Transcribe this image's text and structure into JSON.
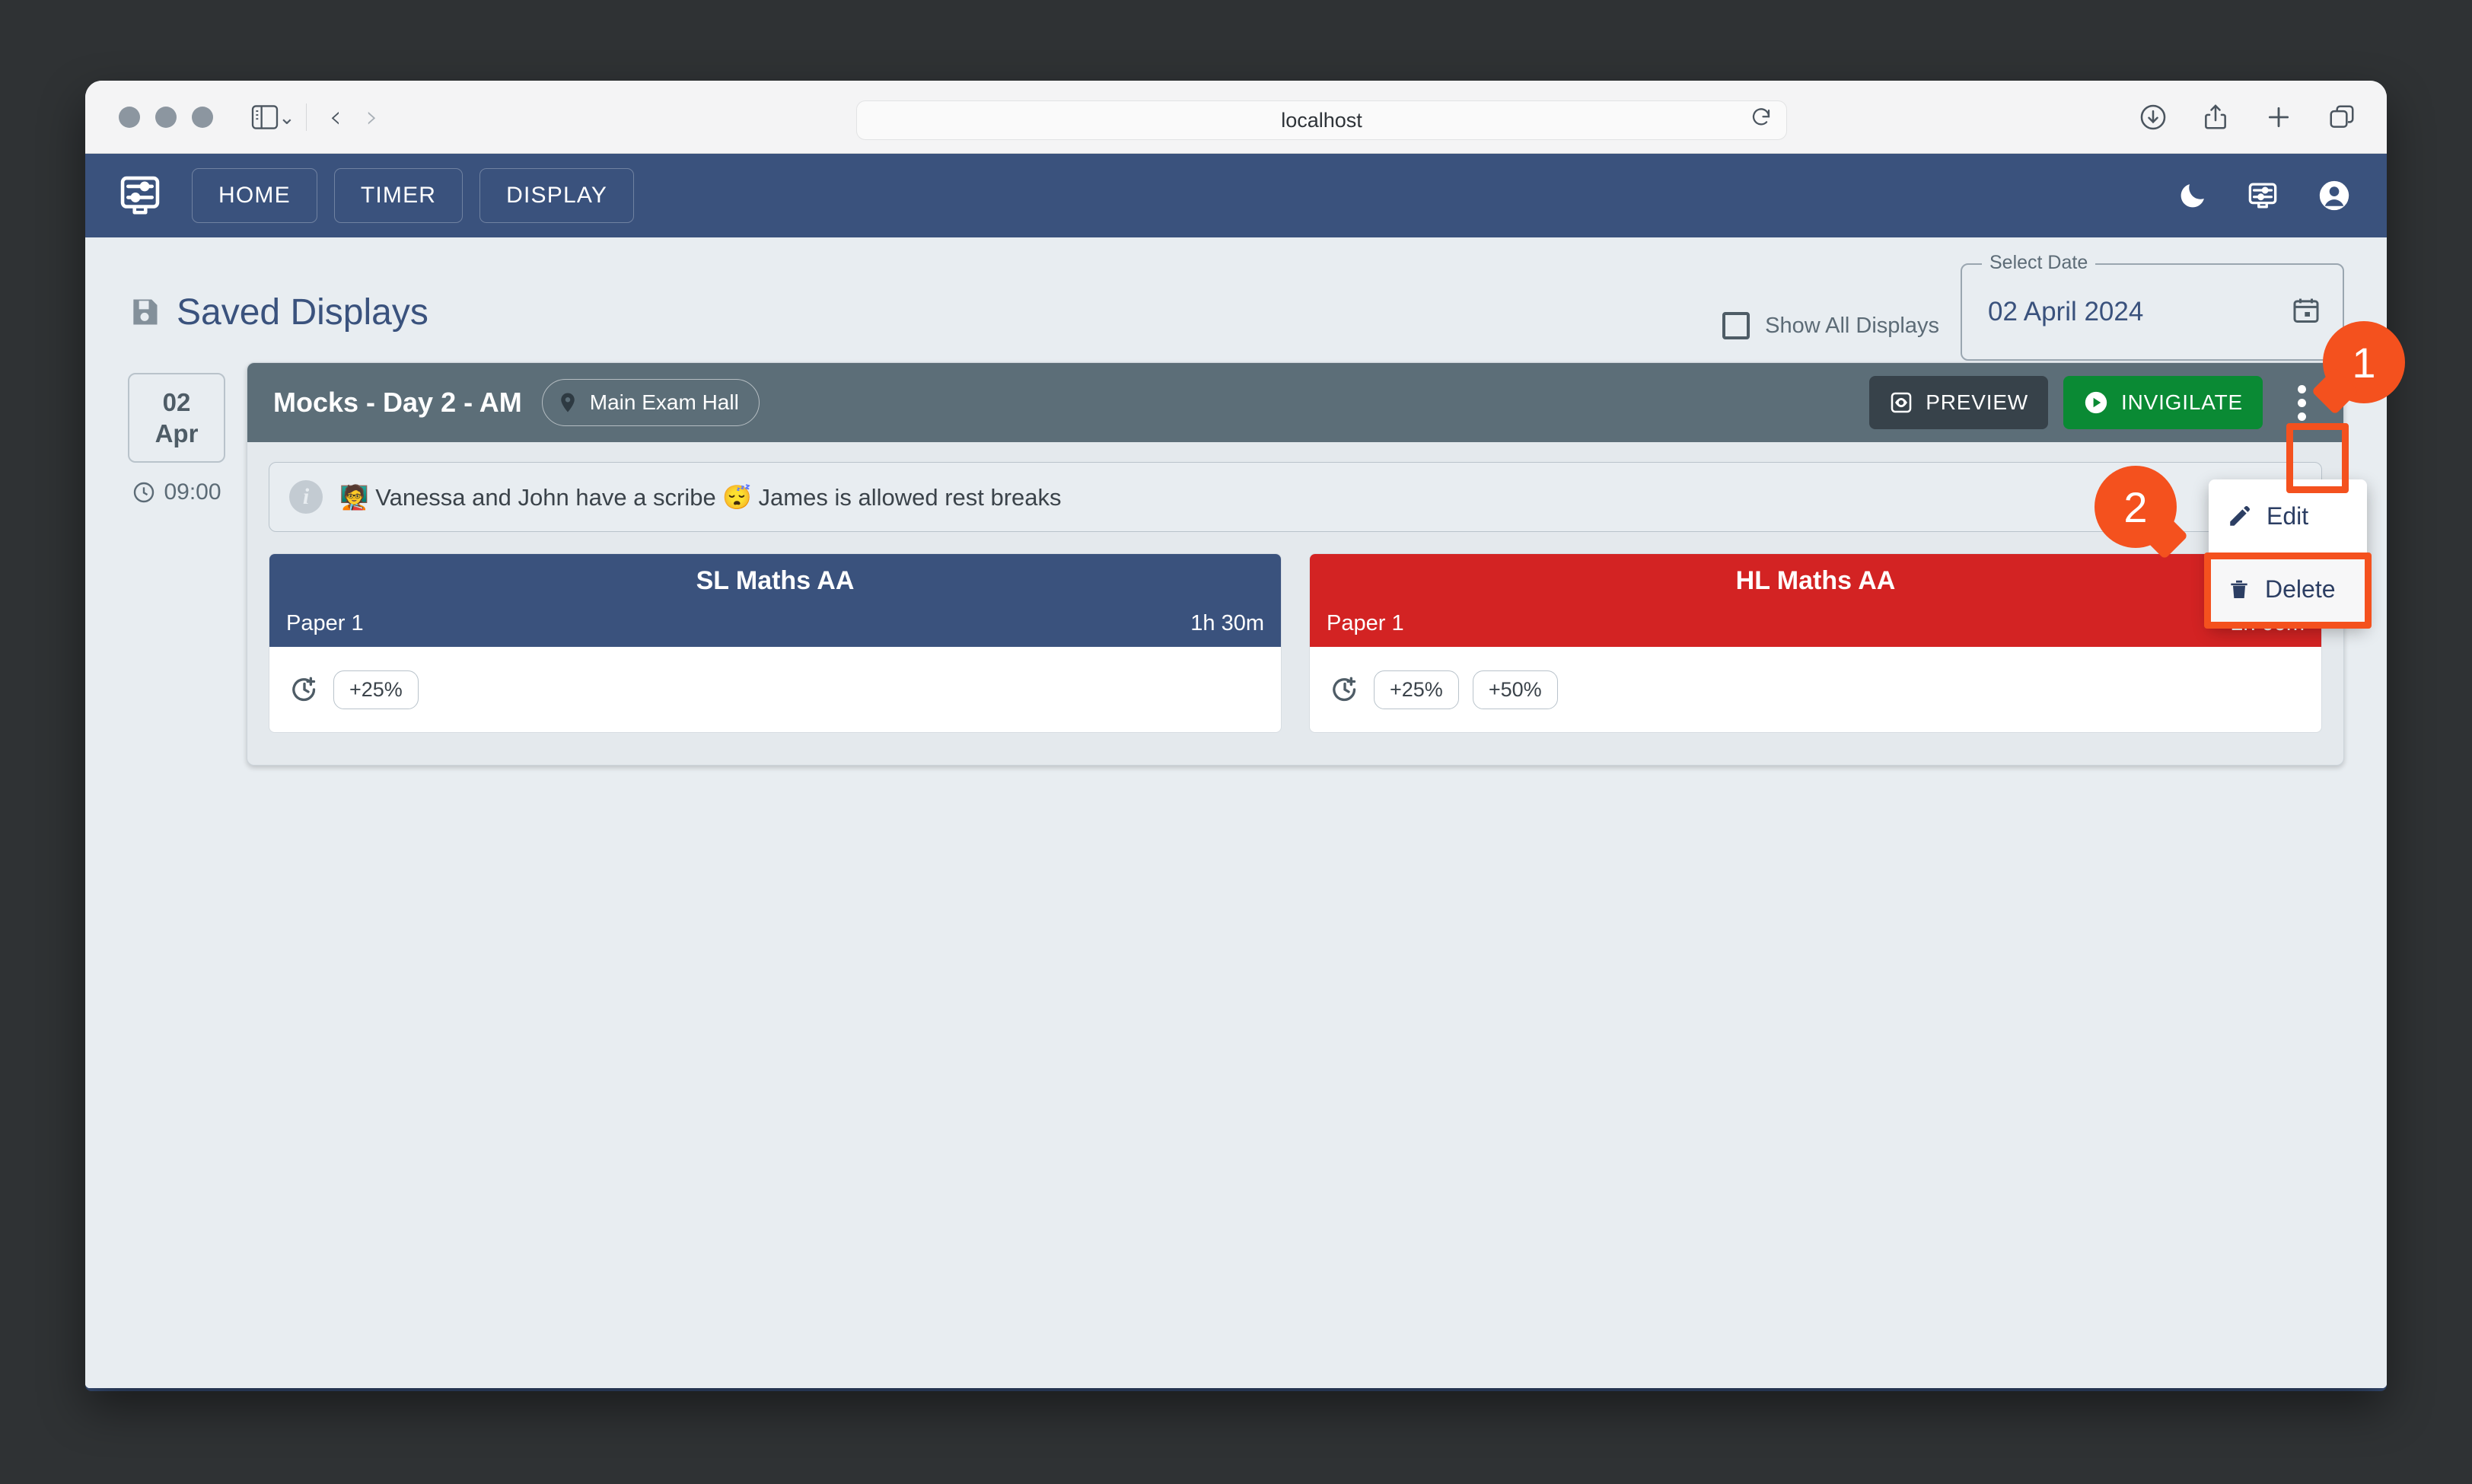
{
  "browser": {
    "url": "localhost",
    "reload_icon": "reload-icon",
    "sidebar_icon": "sidebar-toggle-icon",
    "back_icon": "back-chevron-icon",
    "forward_icon": "forward-chevron-icon",
    "downloads_icon": "downloads-icon",
    "share_icon": "share-icon",
    "newtab_icon": "new-tab-icon",
    "tabs_icon": "tab-overview-icon"
  },
  "appbar": {
    "logo_icon": "display-settings-logo",
    "links": [
      {
        "label": "HOME"
      },
      {
        "label": "TIMER"
      },
      {
        "label": "DISPLAY"
      }
    ],
    "right_icons": [
      {
        "name": "dark-mode-moon-icon"
      },
      {
        "name": "display-settings-icon"
      },
      {
        "name": "account-avatar-icon"
      }
    ]
  },
  "page": {
    "title": "Saved Displays",
    "title_icon": "save-floppy-icon",
    "show_all_label": "Show All Displays",
    "show_all_checked": false,
    "date_legend": "Select Date",
    "date_value": "02 April 2024",
    "calendar_icon": "calendar-icon"
  },
  "day": {
    "day_number": "02",
    "month": "Apr",
    "clock_icon": "clock-icon",
    "time": "09:00"
  },
  "card": {
    "title": "Mocks - Day 2 - AM",
    "room_icon": "location-pin-icon",
    "room": "Main Exam Hall",
    "preview_label": "PREVIEW",
    "preview_icon": "preview-eye-icon",
    "invigilate_label": "INVIGILATE",
    "invigilate_icon": "play-circle-icon",
    "kebab_icon": "more-vertical-icon",
    "info_icon": "info-circle-icon",
    "info_text": "🧑‍🏫 Vanessa and John have a scribe 😴 James is allowed rest breaks"
  },
  "exams": [
    {
      "name": "SL Maths AA",
      "paper": "Paper 1",
      "duration": "1h 30m",
      "color": "#3a527d",
      "extra_time_icon": "extra-time-icon",
      "extensions": [
        "+25%"
      ]
    },
    {
      "name": "HL Maths AA",
      "paper": "Paper 1",
      "duration": "2h 00m",
      "color": "#d32323",
      "extra_time_icon": "extra-time-icon",
      "extensions": [
        "+25%",
        "+50%"
      ]
    }
  ],
  "menu": {
    "items": [
      {
        "label": "Edit",
        "icon": "pencil-edit-icon"
      },
      {
        "label": "Delete",
        "icon": "trash-delete-icon"
      }
    ]
  },
  "annotations": {
    "accent": "#f4511e",
    "steps": [
      {
        "number": "1",
        "target": "more-options-kebab-button"
      },
      {
        "number": "2",
        "target": "delete-menu-item"
      }
    ]
  }
}
